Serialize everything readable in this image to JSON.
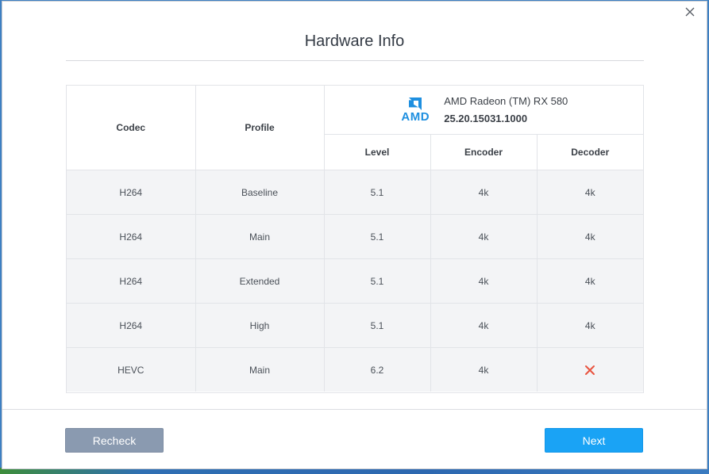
{
  "dialog": {
    "title": "Hardware Info",
    "close_icon": "close-icon"
  },
  "gpu": {
    "vendor_logo_text": "AMD",
    "name": "AMD Radeon (TM) RX 580",
    "driver_version": "25.20.15031.1000",
    "brand_color": "#1e8fe0"
  },
  "table": {
    "headers": {
      "codec": "Codec",
      "profile": "Profile",
      "level": "Level",
      "encoder": "Encoder",
      "decoder": "Decoder"
    },
    "rows": [
      {
        "codec": "H264",
        "profile": "Baseline",
        "level": "5.1",
        "encoder": "4k",
        "decoder": "4k"
      },
      {
        "codec": "H264",
        "profile": "Main",
        "level": "5.1",
        "encoder": "4k",
        "decoder": "4k"
      },
      {
        "codec": "H264",
        "profile": "Extended",
        "level": "5.1",
        "encoder": "4k",
        "decoder": "4k"
      },
      {
        "codec": "H264",
        "profile": "High",
        "level": "5.1",
        "encoder": "4k",
        "decoder": "4k"
      },
      {
        "codec": "HEVC",
        "profile": "Main",
        "level": "6.2",
        "encoder": "4k",
        "decoder_icon": "unsupported-x-icon"
      }
    ]
  },
  "buttons": {
    "recheck_label": "Recheck",
    "next_label": "Next"
  },
  "colors": {
    "primary": "#1aa3f5",
    "secondary": "#8a9ab0",
    "unsupported": "#e8543f"
  }
}
